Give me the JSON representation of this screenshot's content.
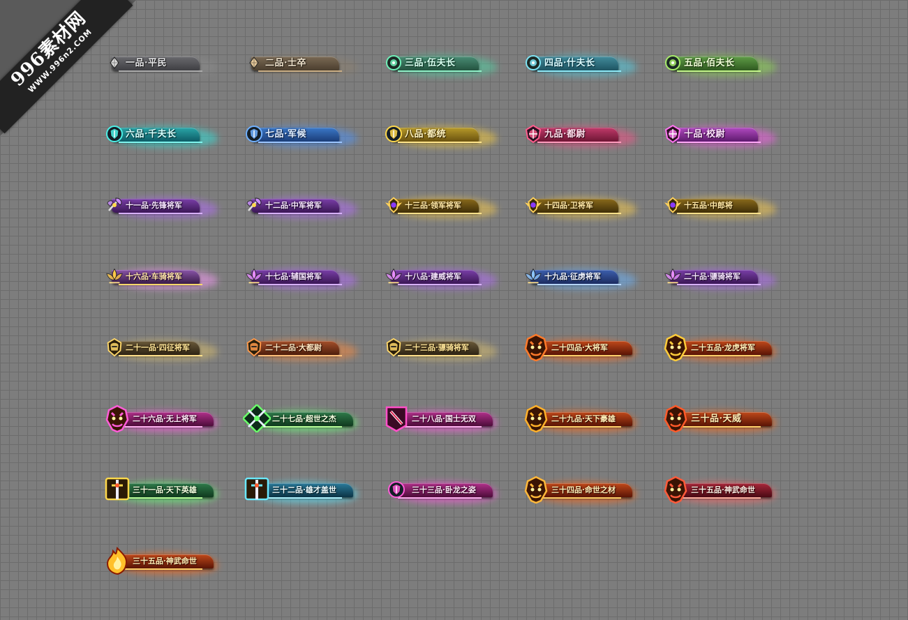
{
  "watermark": {
    "main": "996素材网",
    "url": "WWW.996n2.COM"
  },
  "badges": [
    {
      "label": "一品·平民",
      "tier": "t1",
      "icon": "diamond-icon",
      "accent": "#dcdcdc"
    },
    {
      "label": "二品·士卒",
      "tier": "t2",
      "icon": "diamond-icon",
      "accent": "#e6c99a"
    },
    {
      "label": "三品·伍夫长",
      "tier": "t3",
      "icon": "orb-emblem-icon",
      "accent": "#6ff0b8"
    },
    {
      "label": "四品·什夫长",
      "tier": "t4",
      "icon": "orb-emblem-icon",
      "accent": "#7ee4f4"
    },
    {
      "label": "五品·佰夫长",
      "tier": "t5",
      "icon": "orb-emblem-icon",
      "accent": "#a8ec6a"
    },
    {
      "label": "六品·千夫长",
      "tier": "t6",
      "icon": "shield-emblem-icon",
      "accent": "#4af0e6"
    },
    {
      "label": "七品·军候",
      "tier": "t7",
      "icon": "shield-emblem-icon",
      "accent": "#6fb0ff"
    },
    {
      "label": "八品·都统",
      "tier": "t8",
      "icon": "shield-emblem-icon",
      "accent": "#ffd84a"
    },
    {
      "label": "九品·都尉",
      "tier": "t9",
      "icon": "crest-emblem-icon",
      "accent": "#ff5c8c"
    },
    {
      "label": "十品·校尉",
      "tier": "t10",
      "icon": "crest-emblem-icon",
      "accent": "#ff74f2"
    },
    {
      "label": "十一品·先锋将军",
      "tier": "tp",
      "icon": "axe-emblem-icon",
      "accent": "#c98aff"
    },
    {
      "label": "十二品·中军将军",
      "tier": "tp",
      "icon": "axe-emblem-icon",
      "accent": "#c98aff"
    },
    {
      "label": "十三品·领军将军",
      "tier": "tg",
      "icon": "winged-emblem-icon",
      "accent": "#ffd15a"
    },
    {
      "label": "十四品·卫将军",
      "tier": "tg",
      "icon": "winged-emblem-icon",
      "accent": "#ffd15a"
    },
    {
      "label": "十五品·中郎将",
      "tier": "tg",
      "icon": "winged-emblem-icon",
      "accent": "#ffd15a"
    },
    {
      "label": "十六品·车骑将军",
      "tier": "tpg",
      "icon": "lotus-emblem-icon",
      "accent": "#ffc84a"
    },
    {
      "label": "十七品·辅国将军",
      "tier": "tp",
      "icon": "lotus-emblem-icon",
      "accent": "#e68cff"
    },
    {
      "label": "十八品·建威将军",
      "tier": "tp",
      "icon": "lotus-emblem-icon",
      "accent": "#e68cff"
    },
    {
      "label": "十九品·征虏将军",
      "tier": "tb",
      "icon": "lotus-emblem-icon",
      "accent": "#8cc4ff"
    },
    {
      "label": "二十品·骠骑将军",
      "tier": "tp",
      "icon": "lotus-emblem-icon",
      "accent": "#e68cff"
    },
    {
      "label": "二十一品·四征将军",
      "tier": "tgd",
      "icon": "helmet-emblem-icon",
      "accent": "#ffd86a"
    },
    {
      "label": "二十二品·大都尉",
      "tier": "tor",
      "icon": "helmet-emblem-icon",
      "accent": "#ff9a4a"
    },
    {
      "label": "二十三品·骠骑将军",
      "tier": "tgd",
      "icon": "helmet-emblem-icon",
      "accent": "#ffd86a"
    },
    {
      "label": "二十四品·大将军",
      "tier": "tfire",
      "icon": "beast-emblem-icon",
      "accent": "#ff7a2a"
    },
    {
      "label": "二十五品·龙虎将军",
      "tier": "tfire",
      "icon": "beast-emblem-icon",
      "accent": "#ffcc3a"
    },
    {
      "label": "二十六品·无上将军",
      "tier": "tmag",
      "icon": "beast-emblem-icon",
      "accent": "#ff5cd8"
    },
    {
      "label": "二十七品·超世之杰",
      "tier": "tgreen",
      "icon": "crossed-swords-icon",
      "accent": "#6aff6a"
    },
    {
      "label": "二十八品·国士无双",
      "tier": "tmag",
      "icon": "scroll-emblem-icon",
      "accent": "#ff4fc8"
    },
    {
      "label": "二十九品·天下豪雄",
      "tier": "tfire",
      "icon": "beast-emblem-icon",
      "accent": "#ffb02a"
    },
    {
      "label": "三十品·天威",
      "tier": "tfire",
      "icon": "beast-emblem-icon",
      "accent": "#ff5a2a"
    },
    {
      "label": "三十一品·天下英雄",
      "tier": "tgreen",
      "icon": "sword-emblem-icon",
      "accent": "#ffd84a"
    },
    {
      "label": "三十二品·雄才盖世",
      "tier": "tcyan",
      "icon": "sword-emblem-icon",
      "accent": "#6ae8ff"
    },
    {
      "label": "三十三品·卧龙之姿",
      "tier": "tmag",
      "icon": "shield-emblem-icon",
      "accent": "#ff5cd8"
    },
    {
      "label": "三十四品·命世之材",
      "tier": "tfire",
      "icon": "beast-emblem-icon",
      "accent": "#ffb83a"
    },
    {
      "label": "三十五品·神武命世",
      "tier": "tred",
      "icon": "beast-emblem-icon",
      "accent": "#ff5a3a"
    },
    {
      "label": "三十五品·神武命世",
      "tier": "tfire",
      "icon": "flame-emblem-icon",
      "accent": "#ffc02a"
    }
  ]
}
